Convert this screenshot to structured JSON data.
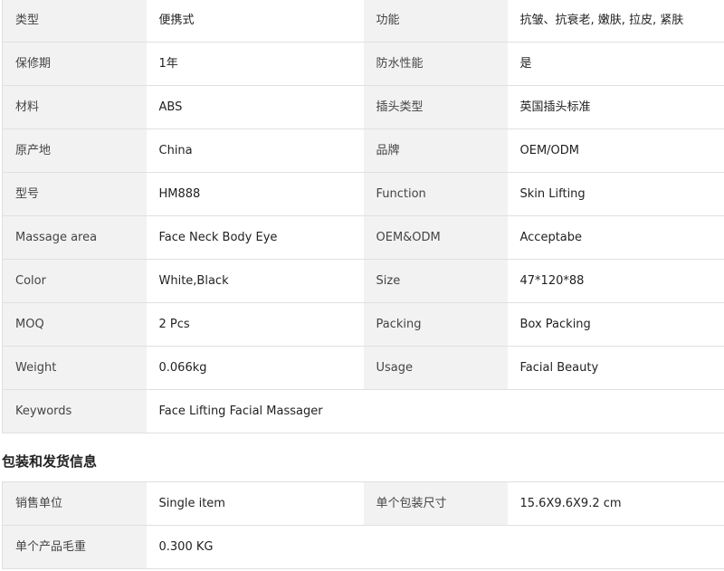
{
  "attributes": [
    {
      "k1": "类型",
      "v1": "便携式",
      "k2": "功能",
      "v2": "抗皱、抗衰老, 嫩肤, 拉皮, 紧肤"
    },
    {
      "k1": "保修期",
      "v1": "1年",
      "k2": "防水性能",
      "v2": "是"
    },
    {
      "k1": "材料",
      "v1": "ABS",
      "k2": "插头类型",
      "v2": "英国插头标准"
    },
    {
      "k1": "原产地",
      "v1": "China",
      "k2": "品牌",
      "v2": "OEM/ODM"
    },
    {
      "k1": "型号",
      "v1": "HM888",
      "k2": "Function",
      "v2": "Skin Lifting"
    },
    {
      "k1": "Massage area",
      "v1": "Face Neck Body Eye",
      "k2": "OEM&ODM",
      "v2": "Acceptabe"
    },
    {
      "k1": "Color",
      "v1": "White,Black",
      "k2": "Size",
      "v2": "47*120*88"
    },
    {
      "k1": "MOQ",
      "v1": "2 Pcs",
      "k2": "Packing",
      "v2": "Box Packing"
    },
    {
      "k1": "Weight",
      "v1": "0.066kg",
      "k2": "Usage",
      "v2": "Facial Beauty"
    },
    {
      "k1": "Keywords",
      "v1": "Face Lifting Facial Massager"
    }
  ],
  "packaging": {
    "title": "包装和发货信息",
    "rows": [
      {
        "k1": "销售单位",
        "v1": "Single item",
        "k2": "单个包装尺寸",
        "v2": "15.6X9.6X9.2 cm"
      },
      {
        "k1": "单个产品毛重",
        "v1": "0.300 KG"
      }
    ]
  }
}
